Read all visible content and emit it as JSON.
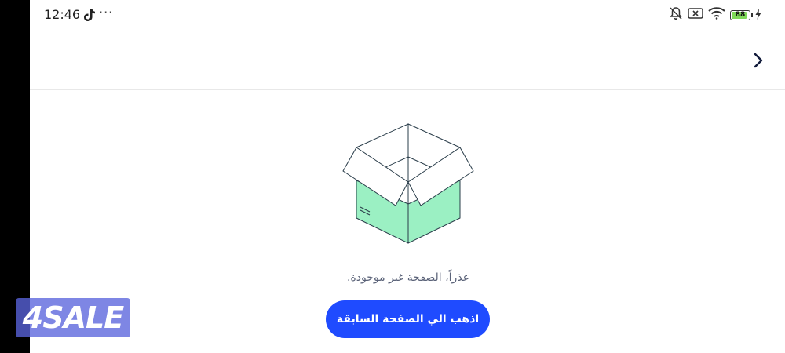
{
  "status_bar": {
    "time": "12:46",
    "more_indicator": "···",
    "icons": [
      "tiktok-icon",
      "mute-icon",
      "no-sim-icon",
      "wifi-icon",
      "battery-icon",
      "charging-icon"
    ],
    "battery_level": "88",
    "battery_fill_percent": 88,
    "battery_color": "#7ed957"
  },
  "header": {
    "back_icon": "chevron-right-icon"
  },
  "empty_state": {
    "illustration": "open-box-icon",
    "box_color": "#9bf0c3",
    "message": "عذراً، الصفحة غير موجودة.",
    "button_label": "اذهب الي الصفحة السابقة",
    "button_color": "#1f4bff"
  },
  "watermark": {
    "text": "4SALE",
    "color": "#5a64dc"
  }
}
